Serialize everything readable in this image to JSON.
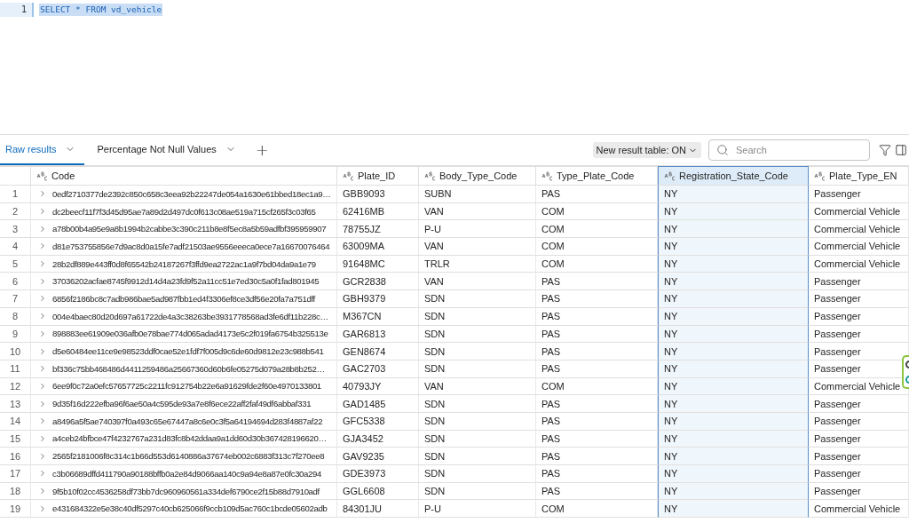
{
  "editor": {
    "lines": [
      {
        "number": "1",
        "text": "SELECT * FROM vd_vehicle",
        "selected": true
      }
    ]
  },
  "result_tabs": [
    {
      "label": "Raw results",
      "selected": true
    },
    {
      "label": "Percentage Not Null Values",
      "selected": false
    }
  ],
  "add_tab": "+",
  "toolbar": {
    "toggle": "New result table: ON",
    "search": {
      "placeholder": "Search"
    }
  },
  "table": {
    "columns": [
      {
        "label": "Code",
        "selected": false
      },
      {
        "label": "Plate_ID",
        "selected": false
      },
      {
        "label": "Body_Type_Code",
        "selected": false
      },
      {
        "label": "Type_Plate_Code",
        "selected": false
      },
      {
        "label": "Registration_State_Code",
        "selected": true
      },
      {
        "label": "Plate_Type_EN",
        "selected": false
      }
    ],
    "rows": [
      {
        "number": "1",
        "cells": [
          "0edf2710377de2392c850c658c3eea92b22247de054a1630e61bbed18ec1a9…",
          "GBB9093",
          "SUBN",
          "PAS",
          "NY",
          "Passenger"
        ]
      },
      {
        "number": "2",
        "cells": [
          "dc2beecf11f7f3d45d95ae7a89d2d497dc0f613c08ae519a715cf265f3c03f65",
          "62416MB",
          "VAN",
          "COM",
          "NY",
          "Commercial Vehicle"
        ]
      },
      {
        "number": "3",
        "cells": [
          "a78b00b4a95e9a8b1994b2cabbe3c390c211b8e8f5ec8a5b59adfbf395959907",
          "78755JZ",
          "P-U",
          "COM",
          "NY",
          "Commercial Vehicle"
        ]
      },
      {
        "number": "4",
        "cells": [
          "d81e753755856e7d9ac8d0a15fe7adf21503ae9556eeeca0ece7a16670076464",
          "63009MA",
          "VAN",
          "COM",
          "NY",
          "Commercial Vehicle"
        ]
      },
      {
        "number": "5",
        "cells": [
          "28b2df889e443ff0d8f65542b24187267f3ffd9ea2722ac1a9f7bd04da9a1e79",
          "91648MC",
          "TRLR",
          "COM",
          "NY",
          "Commercial Vehicle"
        ]
      },
      {
        "number": "6",
        "cells": [
          "37036202acfae8745f9912d14d4a23fd9f52a11cc51e7ed30c5a0f1fad801945",
          "GCR2838",
          "VAN",
          "PAS",
          "NY",
          "Passenger"
        ]
      },
      {
        "number": "7",
        "cells": [
          "6856f2186bc8c7adb986bae5ad987fbb1ed4f3306ef8ce3df56e20fa7a751dff",
          "GBH9379",
          "SDN",
          "PAS",
          "NY",
          "Passenger"
        ]
      },
      {
        "number": "8",
        "cells": [
          "004e4baec80d20d697a61722de4a3c38263be3931778568ad3fe6df11b228c…",
          "M367CN",
          "SDN",
          "PAS",
          "NY",
          "Passenger"
        ]
      },
      {
        "number": "9",
        "cells": [
          "898883ee61909e036afb0e78bae774d065adad4173e5c2f019fa6754b325513e",
          "GAR6813",
          "SDN",
          "PAS",
          "NY",
          "Passenger"
        ]
      },
      {
        "number": "10",
        "cells": [
          "d5e60484ee11ce9e98523ddf0cae52e1fdf7f005d9c6de60d9812e23c988b541",
          "GEN8674",
          "SDN",
          "PAS",
          "NY",
          "Passenger"
        ]
      },
      {
        "number": "11",
        "cells": [
          "bf336c75bb468486d4411259486a25667360d60b6fe05275d079a28b8b252…",
          "GAC2703",
          "SDN",
          "PAS",
          "NY",
          "Passenger"
        ]
      },
      {
        "number": "12",
        "cells": [
          "6ee9f0c72a0efc57657725c2211fc912754b22e6a91629fde2f60e4970133801",
          "40793JY",
          "VAN",
          "COM",
          "NY",
          "Commercial Vehicle"
        ]
      },
      {
        "number": "13",
        "cells": [
          "9d35f16d222efba96f6ae50a4c595de93a7e8f6ece22aff2faf49df6abbaf331",
          "GAD1485",
          "SDN",
          "PAS",
          "NY",
          "Passenger"
        ]
      },
      {
        "number": "14",
        "cells": [
          "a8496a5f5ae740397f0a493c65e67447a8c6e0c3f5a64194694d283f4887af22",
          "GFC5338",
          "SDN",
          "PAS",
          "NY",
          "Passenger"
        ]
      },
      {
        "number": "15",
        "cells": [
          "a4ceb24bfbce47f4232767a231d83fc8b42ddaa9a1dd60d30b367428196620…",
          "GJA3452",
          "SDN",
          "PAS",
          "NY",
          "Passenger"
        ]
      },
      {
        "number": "16",
        "cells": [
          "2565f2181006f8c314c1b66d553d6140886a37674eb002c6883f313c7f270ee8",
          "GAV9235",
          "SDN",
          "PAS",
          "NY",
          "Passenger"
        ]
      },
      {
        "number": "17",
        "cells": [
          "c3b06689dffd411790a90188bffb0a2e84d9066aa140c9a94e8a87e0fc30a294",
          "GDE3973",
          "SDN",
          "PAS",
          "NY",
          "Passenger"
        ]
      },
      {
        "number": "18",
        "cells": [
          "9f5b10f02cc4536258df73bb7dc960960561a334def6790ce2f15b88d7910adf",
          "GGL6608",
          "SDN",
          "PAS",
          "NY",
          "Passenger"
        ]
      },
      {
        "number": "19",
        "cells": [
          "e431684322e5e38c40df5297c40cb625066f9ccb109d5ac760c1bcde05602adb",
          "84301JU",
          "P-U",
          "COM",
          "NY",
          "Commercial Vehicle"
        ]
      }
    ]
  }
}
